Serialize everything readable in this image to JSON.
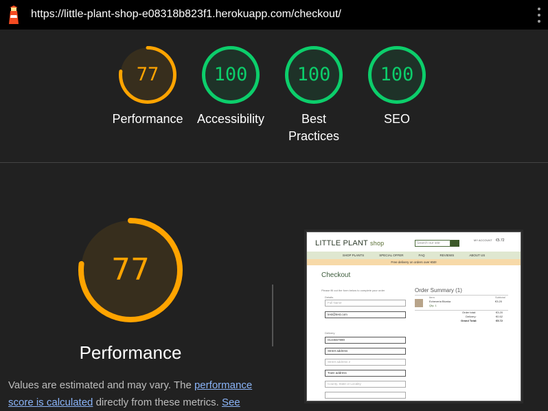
{
  "browser": {
    "url": "https://little-plant-shop-e08318b823f1.herokuapp.com/checkout/"
  },
  "summary": [
    {
      "label": "Performance",
      "score": "77",
      "color": "#ffa400",
      "fraction": 0.77
    },
    {
      "label": "Accessibility",
      "score": "100",
      "color": "#0cce6b",
      "fraction": 1.0
    },
    {
      "label": "Best\nPractices",
      "score": "100",
      "color": "#0cce6b",
      "fraction": 1.0
    },
    {
      "label": "SEO",
      "score": "100",
      "color": "#0cce6b",
      "fraction": 1.0
    }
  ],
  "detail": {
    "score": "77",
    "fraction": 0.77,
    "title": "Performance",
    "desc_prefix": "Values are estimated and may vary. The ",
    "desc_link": "performance score is calculated",
    "desc_suffix": " directly from these metrics. ",
    "desc_link2": "See"
  },
  "thumbnail": {
    "logo_main": "LITTLE PLANT",
    "logo_sub": "shop",
    "search_placeholder": "Search our site",
    "account": "MY ACCOUNT",
    "bag_total": "€5.72",
    "nav": [
      "SHOP PLANTS",
      "SPECIAL OFFER",
      "FAQ",
      "REVIEWS",
      "ABOUT US"
    ],
    "banner": "Free delivery on orders over €50!",
    "heading": "Checkout",
    "instructions": "Please fill out the form below to complete your order",
    "details_label": "Details",
    "full_name": "Full Name",
    "email": "test@test.com",
    "delivery_label": "Delivery",
    "phone": "0134567890",
    "street1": "Street address",
    "street2": "Street address 2",
    "town": "Town address",
    "county": "County, State or Locality",
    "order_summary": "Order Summary (1)",
    "item_col": "Item",
    "subtotal_col": "Subtotal",
    "product_name": "Echeveria Blunka",
    "product_qty": "Qty: 1",
    "product_price": "€3.20",
    "order_total_label": "Order total:",
    "order_total": "€3.20",
    "delivery_cost_label": "Delivery:",
    "delivery_cost": "€0.52",
    "grand_total_label": "Grand Total:",
    "grand_total": "€5.72"
  }
}
